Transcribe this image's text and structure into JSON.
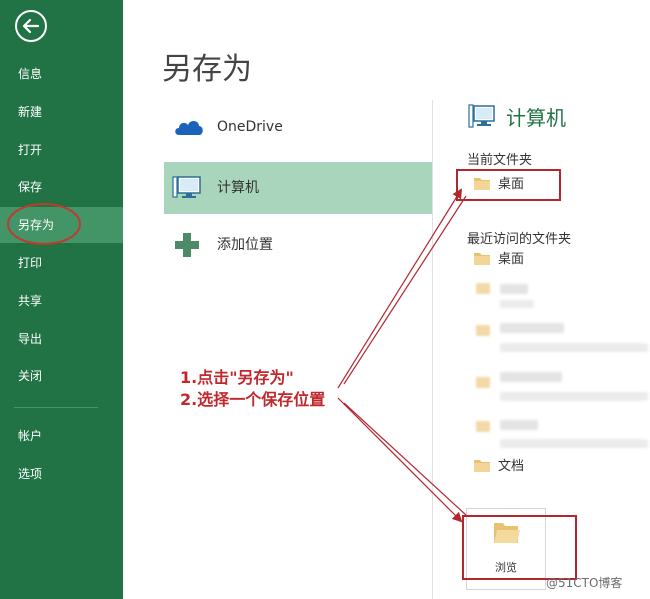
{
  "sidebar": {
    "items": [
      {
        "label": "信息"
      },
      {
        "label": "新建"
      },
      {
        "label": "打开"
      },
      {
        "label": "保存"
      },
      {
        "label": "另存为"
      },
      {
        "label": "打印"
      },
      {
        "label": "共享"
      },
      {
        "label": "导出"
      },
      {
        "label": "关闭"
      },
      {
        "label": "帐户"
      },
      {
        "label": "选项"
      }
    ]
  },
  "page": {
    "title": "另存为"
  },
  "locations": [
    {
      "label": "OneDrive",
      "icon": "cloud-icon"
    },
    {
      "label": "计算机",
      "icon": "computer-icon",
      "selected": true
    },
    {
      "label": "添加位置",
      "icon": "plus-icon"
    }
  ],
  "right_panel": {
    "title": "计算机",
    "current_folder_header": "当前文件夹",
    "current_folder": "桌面",
    "recent_header": "最近访问的文件夹",
    "recent": [
      {
        "label": "桌面"
      },
      {
        "label": "文档"
      }
    ],
    "browse_label": "浏览"
  },
  "annotation": {
    "line1": "1.点击\"另存为\"",
    "line2": "2.选择一个保存位置"
  },
  "watermark": "@51CTO博客",
  "colors": {
    "sidebar": "#217346",
    "accent": "#217346",
    "selected": "#a9d5bc",
    "annotation": "#c0282d"
  }
}
